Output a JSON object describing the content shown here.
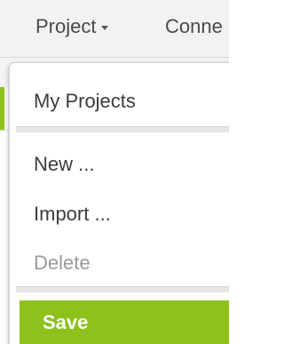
{
  "menubar": {
    "project_label": "Project",
    "connect_label": "Conne"
  },
  "dropdown": {
    "items": [
      {
        "label": "My Projects",
        "enabled": true
      },
      {
        "label": "New ...",
        "enabled": true
      },
      {
        "label": "Import ...",
        "enabled": true
      },
      {
        "label": "Delete",
        "enabled": false
      },
      {
        "label": "Save",
        "enabled": true,
        "highlighted": true
      }
    ]
  },
  "colors": {
    "accent_green": "#8dc11b",
    "menubar_bg": "#f2f2f2",
    "text": "#3c3c3c",
    "disabled_text": "#9a9a9a"
  },
  "icons": {
    "project_dropdown": "chevron-down-icon"
  }
}
